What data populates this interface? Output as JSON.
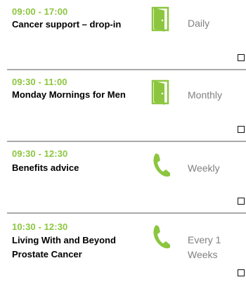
{
  "colors": {
    "accent": "#8cc63f",
    "frequency": "#808080",
    "divider": "#aaaaaa"
  },
  "events": [
    {
      "time": "09:00 - 17:00",
      "title": "Cancer support – drop-in",
      "icon": "door-icon",
      "frequency": "Daily"
    },
    {
      "time": "09:30 - 11:00",
      "title": "Monday Mornings for Men",
      "icon": "door-icon",
      "frequency": "Monthly"
    },
    {
      "time": "09:30 - 12:30",
      "title": "Benefits advice",
      "icon": "phone-icon",
      "frequency": "Weekly"
    },
    {
      "time": "10:30 - 12:30",
      "title": "Living With and Beyond Prostate Cancer",
      "icon": "phone-icon",
      "frequency": "Every 1 Weeks"
    }
  ]
}
